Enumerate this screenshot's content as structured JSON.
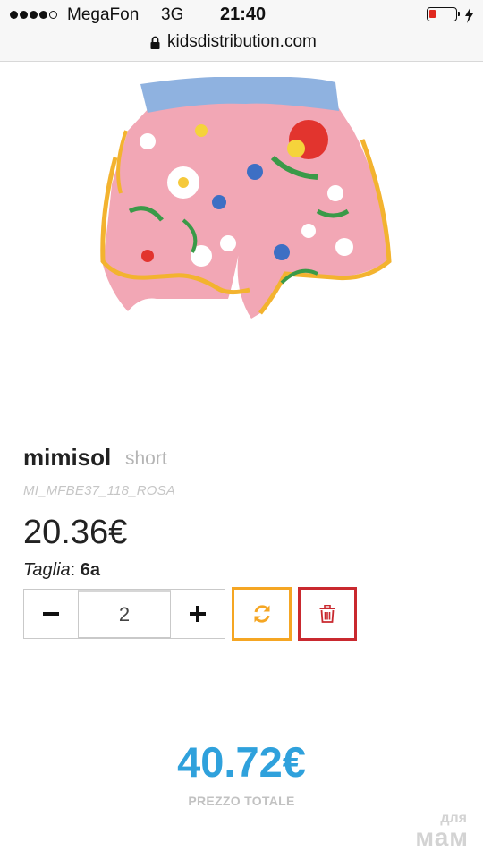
{
  "status_bar": {
    "carrier": "MegaFon",
    "network": "3G",
    "time": "21:40",
    "battery_level": 0.12
  },
  "browser": {
    "url": "kidsdistribution.com"
  },
  "product": {
    "image_icon": "shorts-product-photo",
    "brand": "mimisol",
    "category": "short",
    "sku": "MI_MFBE37_118_ROSA",
    "price": "20.36€",
    "size_label": "Taglia",
    "size_separator": ":",
    "size_value": "6a",
    "quantity": "2"
  },
  "actions": {
    "minus_icon": "minus-icon",
    "plus_icon": "plus-icon",
    "refresh_icon": "refresh-icon",
    "delete_icon": "trash-icon"
  },
  "totals": {
    "total_price": "40.72€",
    "total_label": "PREZZO TOTALE"
  },
  "watermark": {
    "line1": "для",
    "line2": "мам"
  },
  "colors": {
    "total": "#2fa1dc",
    "refresh_border": "#f5a623",
    "delete_border": "#c9292f",
    "battery_low": "#e0281e"
  }
}
